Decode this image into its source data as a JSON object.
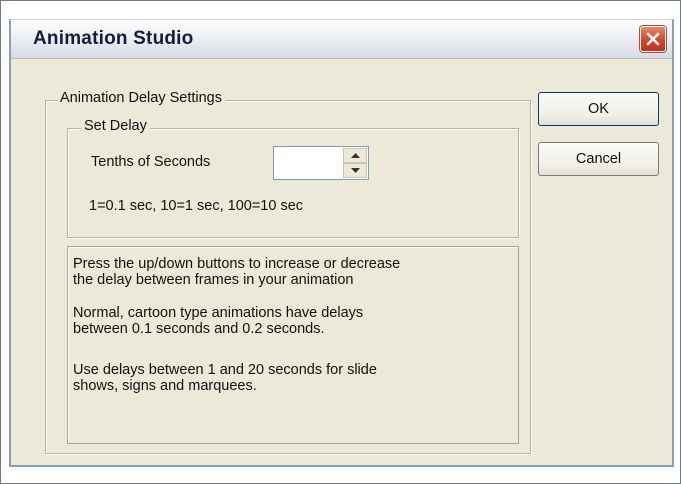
{
  "window": {
    "title": "Animation Studio"
  },
  "groups": {
    "outer_legend": "Animation Delay Settings",
    "inner_legend": "Set Delay"
  },
  "delay": {
    "label": "Tenths of Seconds",
    "value": "",
    "hint": "1=0.1 sec, 10=1 sec, 100=10 sec"
  },
  "buttons": {
    "ok": "OK",
    "cancel": "Cancel"
  },
  "help": {
    "line1": "Press the up/down buttons to increase or decrease",
    "line2": "the delay between frames in your animation",
    "line3": "Normal, cartoon type animations have delays",
    "line4": "between 0.1 seconds and 0.2 seconds.",
    "line5": "Use delays between 1 and 20 seconds for slide",
    "line6": "shows, signs and marquees."
  },
  "icons": {
    "close": "close-icon",
    "spin_up": "arrow-up-icon",
    "spin_down": "arrow-down-icon"
  },
  "colors": {
    "dialog_bg": "#ece9d8",
    "close_button": "#d4462a",
    "button_border": "#003c74"
  }
}
